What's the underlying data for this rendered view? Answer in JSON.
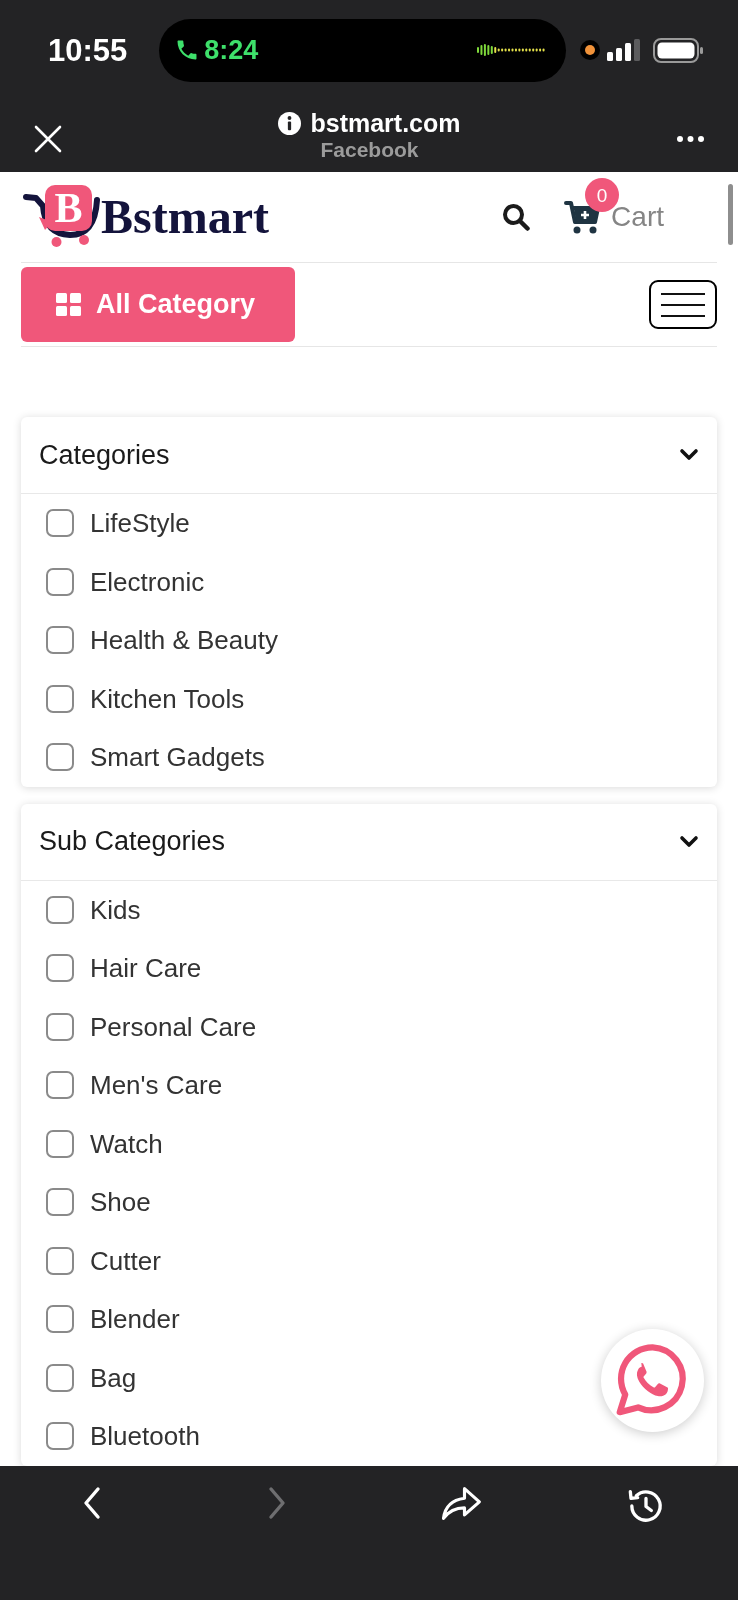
{
  "status_bar": {
    "time": "10:55",
    "call_timer": "8:24"
  },
  "browser_bar": {
    "domain": "bstmart.com",
    "source": "Facebook"
  },
  "header": {
    "logo": {
      "mark_letter": "B",
      "wordmark": "Bstmart"
    },
    "cart": {
      "count": "0",
      "label": "Cart"
    }
  },
  "category_button": {
    "label": "All Category"
  },
  "filters": [
    {
      "title": "Categories",
      "expanded": true,
      "options": [
        {
          "label": "LifeStyle",
          "checked": false
        },
        {
          "label": "Electronic",
          "checked": false
        },
        {
          "label": "Health & Beauty",
          "checked": false
        },
        {
          "label": "Kitchen Tools",
          "checked": false
        },
        {
          "label": "Smart Gadgets",
          "checked": false
        }
      ]
    },
    {
      "title": "Sub Categories",
      "expanded": true,
      "options": [
        {
          "label": "Kids",
          "checked": false
        },
        {
          "label": "Hair Care",
          "checked": false
        },
        {
          "label": "Personal Care",
          "checked": false
        },
        {
          "label": "Men's Care",
          "checked": false
        },
        {
          "label": "Watch",
          "checked": false
        },
        {
          "label": "Shoe",
          "checked": false
        },
        {
          "label": "Cutter",
          "checked": false
        },
        {
          "label": "Blender",
          "checked": false
        },
        {
          "label": "Bag",
          "checked": false
        },
        {
          "label": "Bluetooth",
          "checked": false
        }
      ]
    }
  ],
  "browser_toolbar": [
    {
      "kind": "back",
      "disabled": false
    },
    {
      "kind": "forward",
      "disabled": true
    },
    {
      "kind": "share",
      "disabled": false
    },
    {
      "kind": "history",
      "disabled": false
    }
  ]
}
